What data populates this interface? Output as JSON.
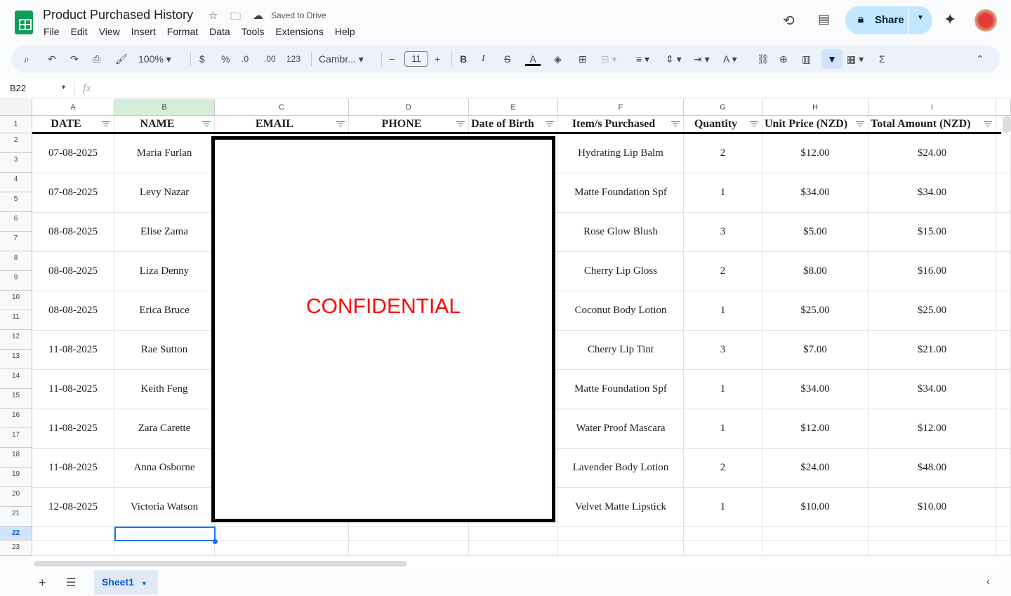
{
  "doc": {
    "title": "Product Purchased History",
    "saved": "Saved to Drive"
  },
  "menu": [
    "File",
    "Edit",
    "View",
    "Insert",
    "Format",
    "Data",
    "Tools",
    "Extensions",
    "Help"
  ],
  "toolbar": {
    "zoom": "100%",
    "currency": "$",
    "percent": "%",
    "dec_dec": ".0",
    "inc_dec": ".00",
    "format": "123",
    "font": "Cambr...",
    "font_size": "11"
  },
  "share": {
    "label": "Share"
  },
  "namebox": "B22",
  "fx": "fx",
  "columns": [
    "A",
    "B",
    "C",
    "D",
    "E",
    "F",
    "G",
    "H",
    "I"
  ],
  "headers": [
    "DATE",
    "NAME",
    "EMAIL",
    "PHONE",
    "Date of Birth",
    "Item/s Purchased",
    "Quantity",
    "Unit Price (NZD)",
    "Total Amount (NZD)"
  ],
  "rows": [
    [
      "07-08-2025",
      "Maria Furlan",
      "Hydrating Lip Balm",
      "2",
      "$12.00",
      "$24.00"
    ],
    [
      "07-08-2025",
      "Levy Nazar",
      "Matte Foundation Spf",
      "1",
      "$34.00",
      "$34.00"
    ],
    [
      "08-08-2025",
      "Elise Zama",
      "Rose Glow Blush",
      "3",
      "$5.00",
      "$15.00"
    ],
    [
      "08-08-2025",
      "Liza Denny",
      "Cherry Lip Gloss",
      "2",
      "$8.00",
      "$16.00"
    ],
    [
      "08-08-2025",
      "Erica Bruce",
      "Coconut Body Lotion",
      "1",
      "$25.00",
      "$25.00"
    ],
    [
      "11-08-2025",
      "Rae Sutton",
      "Cherry Lip Tint",
      "3",
      "$7.00",
      "$21.00"
    ],
    [
      "11-08-2025",
      "Keith Feng",
      "Matte Foundation Spf",
      "1",
      "$34.00",
      "$34.00"
    ],
    [
      "11-08-2025",
      "Zara Carette",
      "Water Proof Mascara",
      "1",
      "$12.00",
      "$12.00"
    ],
    [
      "11-08-2025",
      "Anna Osborne",
      "Lavender Body Lotion",
      "2",
      "$24.00",
      "$48.00"
    ],
    [
      "12-08-2025",
      "Victoria Watson",
      "Velvet Matte Lipstick",
      "1",
      "$10.00",
      "$10.00"
    ]
  ],
  "confidential": "CONFIDENTIAL",
  "sheet_tab": "Sheet1",
  "colors": {
    "accent": "#0b57d0",
    "confidential": "#ff0000",
    "share_bg": "#c2e7ff"
  }
}
